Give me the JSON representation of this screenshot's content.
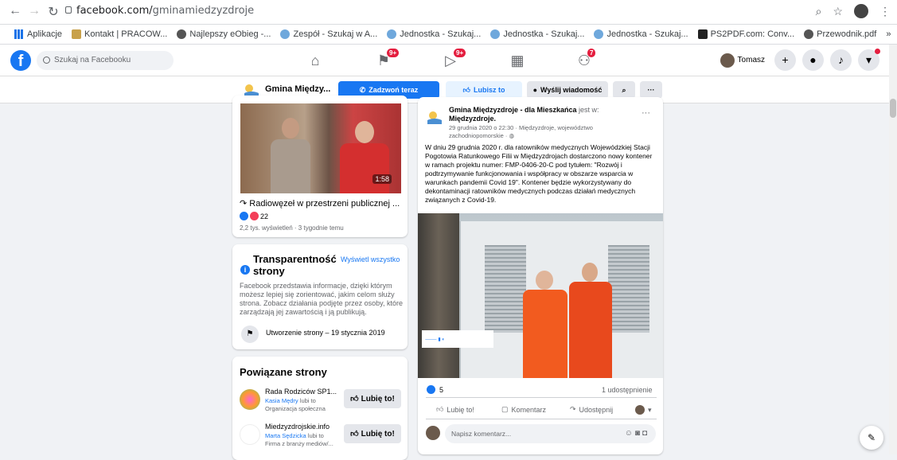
{
  "browser": {
    "url_host": "facebook.com/",
    "url_path": "gminamiedzyzdroje",
    "bookmarks": [
      "Aplikacje",
      "Kontakt | PRACOW...",
      "Najlepszy eObieg -...",
      "Zespół - Szukaj w A...",
      "Jednostka - Szukaj...",
      "Jednostka - Szukaj...",
      "Jednostka - Szukaj...",
      "PS2PDF.com: Conv...",
      "Przewodnik.pdf",
      "»"
    ]
  },
  "fb": {
    "search_placeholder": "Szukaj na Facebooku",
    "badges": {
      "pages": "9+",
      "watch": "9+",
      "groups": "7"
    },
    "user_name": "Tomasz"
  },
  "page_bar": {
    "name": "Gmina Między...",
    "call": "Zadzwoń teraz",
    "like": "Lubisz to",
    "message": "Wyślij wiadomość"
  },
  "video_card": {
    "duration": "1:58",
    "title": "Radiowęzeł w przestrzeni publicznej ...",
    "reactions": "22",
    "meta": "2,2 tys. wyświetleń · 3 tygodnie temu"
  },
  "transparency": {
    "title": "Transparentność strony",
    "link": "Wyświetl wszystko",
    "text": "Facebook przedstawia informacje, dzięki którym możesz lepiej się zorientować, jakim celom służy strona. Zobacz działania podjęte przez osoby, które zarządzają jej zawartością i ją publikują.",
    "created": "Utworzenie strony – 19 stycznia 2019"
  },
  "related": {
    "title": "Powiązane strony",
    "items": [
      {
        "name": "Rada Rodziców SP1...",
        "liker": "Kasia Mędry",
        "liker_suffix": " lubi to",
        "category": "Organizacja społeczna",
        "button": "Lubię to!"
      },
      {
        "name": "Miedzyzdrojskie.info",
        "liker": "Marta Sędzicka",
        "liker_suffix": " lubi to",
        "category": "Firma z branży mediów/...",
        "button": "Lubię to!"
      }
    ]
  },
  "post": {
    "author": "Gmina Międzyzdroje - dla Mieszkańca",
    "is_in": " jest w: ",
    "location": "Międzyzdroje.",
    "date": "29 grudnia 2020 o 22:30 · Międzyzdroje, województwo zachodniopomorskie · ",
    "text": "W dniu 29 grudnia 2020 r. dla ratowników medycznych Wojewódzkiej Stacji Pogotowia Ratunkowego Filii w Międzyzdrojach dostarczono nowy kontener w ramach projektu numer: FMP-0406-20-C pod tytułem: \"Rozwój i podtrzymywanie funkcjonowania i współpracy w obszarze wsparcia w warunkach pandemii Covid 19\". Kontener będzie wykorzystywany do dekontaminacji ratowników medycznych podczas działań medycznych związanych z Covid-19.",
    "reactions": "5",
    "shares": "1 udostępnienie",
    "actions": {
      "like": "Lubię to!",
      "comment": "Komentarz",
      "share": "Udostępnij"
    },
    "comment_placeholder": "Napisz komentarz..."
  }
}
